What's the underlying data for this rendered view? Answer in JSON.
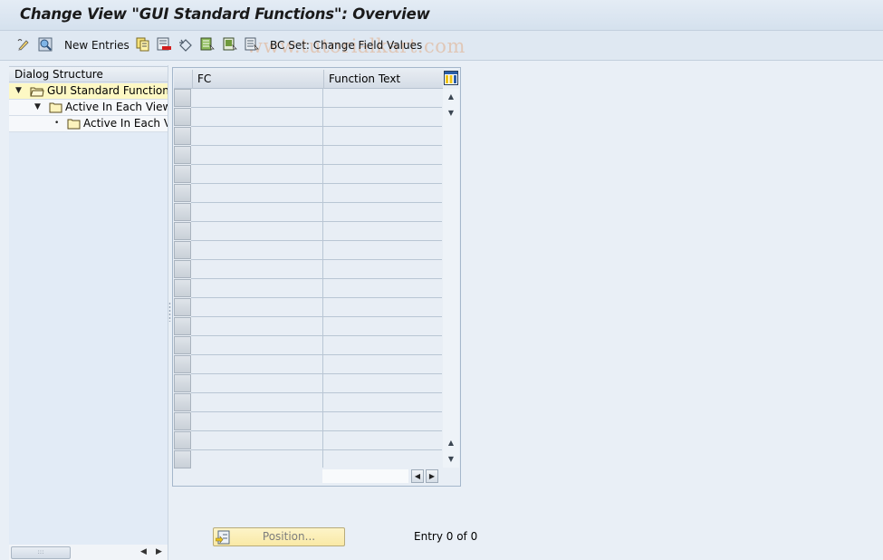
{
  "window": {
    "title": "Change View \"GUI Standard Functions\": Overview"
  },
  "toolbar": {
    "items": [
      {
        "icon": "display-change-icon"
      },
      {
        "icon": "find-icon"
      },
      {
        "label": "New Entries"
      },
      {
        "icon": "copy-as-icon"
      },
      {
        "icon": "delete-icon"
      },
      {
        "icon": "undo-change-icon"
      },
      {
        "icon": "select-all-icon"
      },
      {
        "icon": "select-block-icon"
      },
      {
        "icon": "deselect-all-icon"
      },
      {
        "label": "BC Set: Change Field Values"
      }
    ],
    "new_entries_label": "New Entries",
    "bc_set_label": "BC Set: Change Field Values",
    "watermark": "www.tutorialkart.com"
  },
  "dialog_structure": {
    "header": "Dialog Structure",
    "nodes": [
      {
        "label": "GUI Standard Functions",
        "level": 0,
        "expanded": true,
        "selected": true
      },
      {
        "label": "Active In Each View",
        "level": 1,
        "expanded": true,
        "selected": false
      },
      {
        "label": "Active In Each View",
        "level": 2,
        "expanded": false,
        "selected": false
      }
    ]
  },
  "table": {
    "columns": [
      "FC",
      "Function Text"
    ],
    "rows": [],
    "visible_empty_rows": 20
  },
  "footer": {
    "position_button": "Position...",
    "entry_status": "Entry 0 of 0"
  }
}
